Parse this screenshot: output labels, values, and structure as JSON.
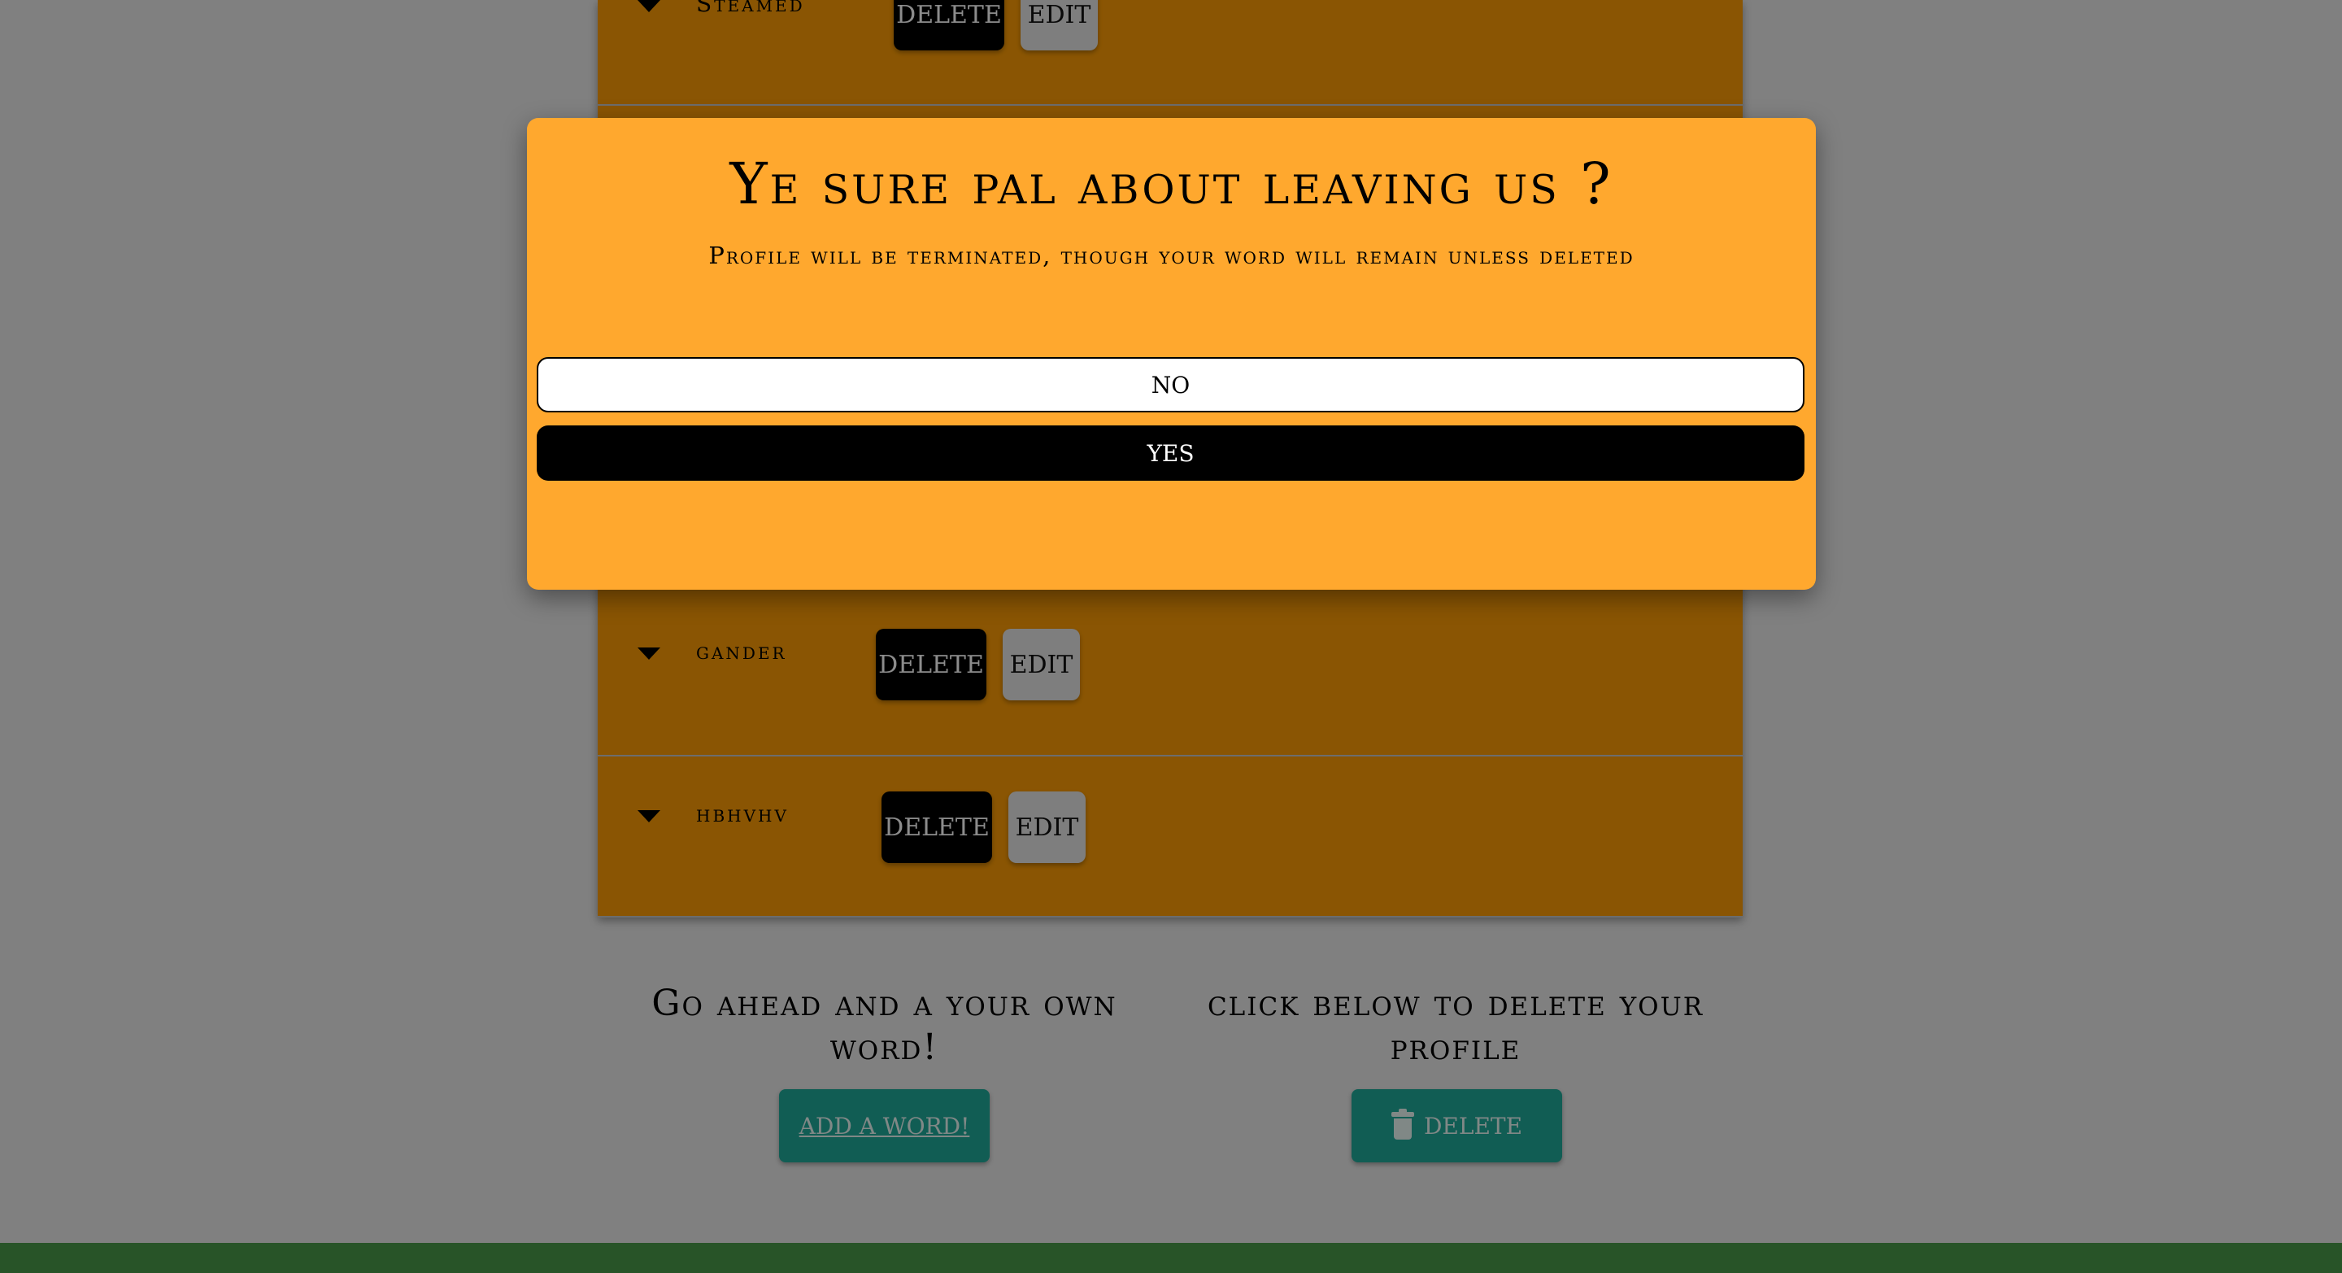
{
  "words": [
    {
      "label": "Steamed",
      "delete_label": "Delete",
      "edit_label": "Edit"
    },
    {
      "label": "gander",
      "delete_label": "Delete",
      "edit_label": "Edit"
    },
    {
      "label": "hbhvhv",
      "delete_label": "Delete",
      "edit_label": "Edit"
    }
  ],
  "add_section": {
    "heading": "Go ahead and a your own word!",
    "button_label": "Add a word!"
  },
  "delete_section": {
    "heading": "click below to delete your profile",
    "button_label": "Delete",
    "icon": "trash-icon"
  },
  "modal": {
    "title": "Ye sure pal about leaving us ?",
    "subtitle": "Profile will be terminated, though your word will remain unless deleted",
    "no_label": "NO",
    "yes_label": "YES"
  },
  "colors": {
    "list_background": "#fc9c06",
    "modal_background": "#ffa82e",
    "teal_button": "#1fa99a",
    "footer": "#4a9a4a"
  }
}
